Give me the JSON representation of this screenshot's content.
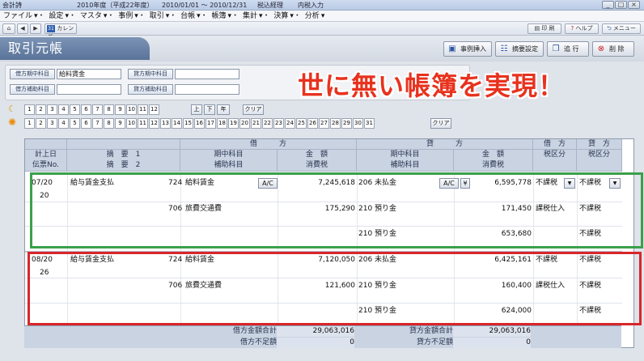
{
  "titlebar": {
    "app": "会計詩",
    "year": "2010年度（平成22年度）",
    "period": "2010/01/01 ～ 2010/12/31",
    "status1": "税込経理",
    "status2": "内税入力"
  },
  "menu": [
    "ファイル",
    "設定",
    "マスタ",
    "事例",
    "取引",
    "台帳",
    "帳簿",
    "集計",
    "決算",
    "分析"
  ],
  "nav": {
    "calendar": "カレンダー",
    "calendar_day": "31"
  },
  "top_right": {
    "print": "印 刷",
    "help": "ヘルプ",
    "menu": "メニュー"
  },
  "page_title": "取引元帳",
  "toolbar": {
    "case_insert": "事例挿入",
    "summary_setting": "摘要設定",
    "carry": "追 行",
    "delete": "削 除"
  },
  "filters": {
    "debit_account_label": "借方期中科目",
    "debit_account_value": "給料賃金",
    "debit_sub_label": "借方補助科目",
    "debit_sub_value": "",
    "credit_account_label": "貸方期中科目",
    "credit_account_value": "",
    "credit_sub_label": "貸方補助科目",
    "credit_sub_value": "",
    "months": [
      "1",
      "2",
      "3",
      "4",
      "5",
      "6",
      "7",
      "8",
      "9",
      "10",
      "11",
      "12"
    ],
    "period_buttons": [
      "上",
      "下",
      "年"
    ],
    "clear": "クリア",
    "days": [
      "1",
      "2",
      "3",
      "4",
      "5",
      "6",
      "7",
      "8",
      "9",
      "10",
      "11",
      "12",
      "13",
      "14",
      "15",
      "16",
      "17",
      "18",
      "19",
      "20",
      "21",
      "22",
      "23",
      "24",
      "25",
      "26",
      "27",
      "28",
      "29",
      "30",
      "31"
    ]
  },
  "banner": "世に無い帳簿を実現！",
  "table": {
    "group_debit": "借　　　方",
    "group_credit": "貸　　　方",
    "col_debit_tax": "借　方",
    "col_credit_tax": "貸　方",
    "h_date": "計上日",
    "h_slip": "伝票No.",
    "h_summary1": "摘　要　1",
    "h_summary2": "摘　要　2",
    "h_debit_acct": "期中科目",
    "h_debit_sub": "補助科目",
    "h_debit_amount": "金　額",
    "h_debit_tax": "消費税",
    "h_credit_acct": "期中科目",
    "h_credit_sub": "補助科目",
    "h_credit_amount": "金　額",
    "h_credit_tax": "消費税",
    "h_debit_taxcat": "税区分",
    "h_credit_taxcat": "税区分",
    "entries": [
      {
        "date": "07/20",
        "slip": "20",
        "summary": "給与賃金支払",
        "lines": [
          {
            "d_code": "724",
            "d_acct": "給料賃金",
            "d_amt": "7,245,618",
            "c_code": "206",
            "c_acct": "未払金",
            "c_amt": "6,595,778",
            "d_tax": "不課税",
            "c_tax": "不課税",
            "ac1": "A/C",
            "ac2": "A/C",
            "yen": "¥"
          },
          {
            "d_code": "706",
            "d_acct": "旅費交通費",
            "d_amt": "175,290",
            "c_code": "210",
            "c_acct": "預り金",
            "c_amt": "171,450",
            "d_tax": "課税仕入",
            "c_tax": "不課税"
          },
          {
            "d_code": "",
            "d_acct": "",
            "d_amt": "",
            "c_code": "210",
            "c_acct": "預り金",
            "c_amt": "653,680",
            "d_tax": "",
            "c_tax": "不課税"
          }
        ]
      },
      {
        "date": "08/20",
        "slip": "26",
        "summary": "給与賃金支払",
        "lines": [
          {
            "d_code": "724",
            "d_acct": "給料賃金",
            "d_amt": "7,120,050",
            "c_code": "206",
            "c_acct": "未払金",
            "c_amt": "6,425,161",
            "d_tax": "不課税",
            "c_tax": "不課税"
          },
          {
            "d_code": "706",
            "d_acct": "旅費交通費",
            "d_amt": "121,600",
            "c_code": "210",
            "c_acct": "預り金",
            "c_amt": "160,400",
            "d_tax": "課税仕入",
            "c_tax": "不課税"
          },
          {
            "d_code": "",
            "d_acct": "",
            "d_amt": "",
            "c_code": "210",
            "c_acct": "預り金",
            "c_amt": "624,000",
            "d_tax": "",
            "c_tax": "不課税"
          }
        ]
      }
    ],
    "totals": {
      "debit_total_label": "借方金額合計",
      "debit_total": "29,063,016",
      "credit_total_label": "貸方金額合計",
      "credit_total": "29,063,016",
      "debit_short_label": "借方不足額",
      "debit_short": "0",
      "credit_short_label": "貸方不足額",
      "credit_short": "0"
    }
  },
  "highlight_colors": {
    "first_entry": "#3aa04a",
    "second_entry": "#d8262a"
  }
}
